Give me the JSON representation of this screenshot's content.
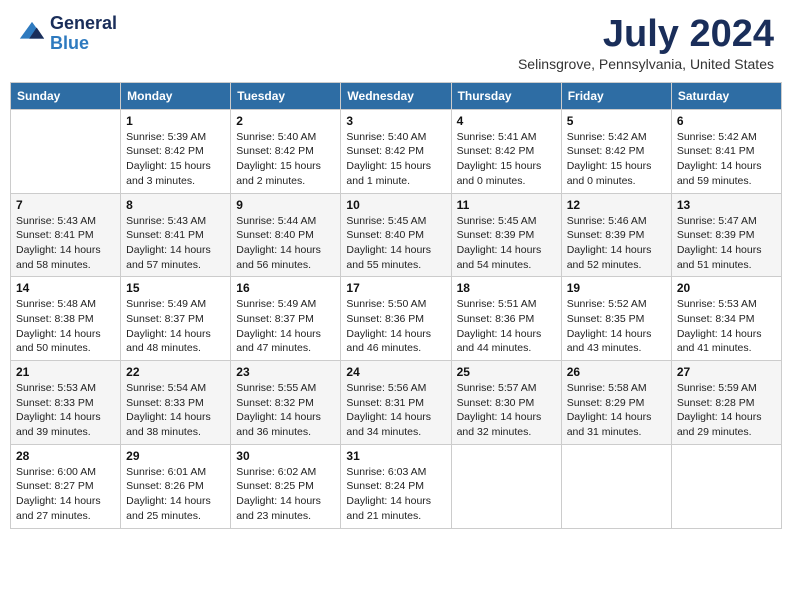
{
  "logo": {
    "general": "General",
    "blue": "Blue"
  },
  "title": "July 2024",
  "location": "Selinsgrove, Pennsylvania, United States",
  "days_of_week": [
    "Sunday",
    "Monday",
    "Tuesday",
    "Wednesday",
    "Thursday",
    "Friday",
    "Saturday"
  ],
  "weeks": [
    [
      {
        "day": "",
        "sunrise": "",
        "sunset": "",
        "daylight": ""
      },
      {
        "day": "1",
        "sunrise": "Sunrise: 5:39 AM",
        "sunset": "Sunset: 8:42 PM",
        "daylight": "Daylight: 15 hours and 3 minutes."
      },
      {
        "day": "2",
        "sunrise": "Sunrise: 5:40 AM",
        "sunset": "Sunset: 8:42 PM",
        "daylight": "Daylight: 15 hours and 2 minutes."
      },
      {
        "day": "3",
        "sunrise": "Sunrise: 5:40 AM",
        "sunset": "Sunset: 8:42 PM",
        "daylight": "Daylight: 15 hours and 1 minute."
      },
      {
        "day": "4",
        "sunrise": "Sunrise: 5:41 AM",
        "sunset": "Sunset: 8:42 PM",
        "daylight": "Daylight: 15 hours and 0 minutes."
      },
      {
        "day": "5",
        "sunrise": "Sunrise: 5:42 AM",
        "sunset": "Sunset: 8:42 PM",
        "daylight": "Daylight: 15 hours and 0 minutes."
      },
      {
        "day": "6",
        "sunrise": "Sunrise: 5:42 AM",
        "sunset": "Sunset: 8:41 PM",
        "daylight": "Daylight: 14 hours and 59 minutes."
      }
    ],
    [
      {
        "day": "7",
        "sunrise": "Sunrise: 5:43 AM",
        "sunset": "Sunset: 8:41 PM",
        "daylight": "Daylight: 14 hours and 58 minutes."
      },
      {
        "day": "8",
        "sunrise": "Sunrise: 5:43 AM",
        "sunset": "Sunset: 8:41 PM",
        "daylight": "Daylight: 14 hours and 57 minutes."
      },
      {
        "day": "9",
        "sunrise": "Sunrise: 5:44 AM",
        "sunset": "Sunset: 8:40 PM",
        "daylight": "Daylight: 14 hours and 56 minutes."
      },
      {
        "day": "10",
        "sunrise": "Sunrise: 5:45 AM",
        "sunset": "Sunset: 8:40 PM",
        "daylight": "Daylight: 14 hours and 55 minutes."
      },
      {
        "day": "11",
        "sunrise": "Sunrise: 5:45 AM",
        "sunset": "Sunset: 8:39 PM",
        "daylight": "Daylight: 14 hours and 54 minutes."
      },
      {
        "day": "12",
        "sunrise": "Sunrise: 5:46 AM",
        "sunset": "Sunset: 8:39 PM",
        "daylight": "Daylight: 14 hours and 52 minutes."
      },
      {
        "day": "13",
        "sunrise": "Sunrise: 5:47 AM",
        "sunset": "Sunset: 8:39 PM",
        "daylight": "Daylight: 14 hours and 51 minutes."
      }
    ],
    [
      {
        "day": "14",
        "sunrise": "Sunrise: 5:48 AM",
        "sunset": "Sunset: 8:38 PM",
        "daylight": "Daylight: 14 hours and 50 minutes."
      },
      {
        "day": "15",
        "sunrise": "Sunrise: 5:49 AM",
        "sunset": "Sunset: 8:37 PM",
        "daylight": "Daylight: 14 hours and 48 minutes."
      },
      {
        "day": "16",
        "sunrise": "Sunrise: 5:49 AM",
        "sunset": "Sunset: 8:37 PM",
        "daylight": "Daylight: 14 hours and 47 minutes."
      },
      {
        "day": "17",
        "sunrise": "Sunrise: 5:50 AM",
        "sunset": "Sunset: 8:36 PM",
        "daylight": "Daylight: 14 hours and 46 minutes."
      },
      {
        "day": "18",
        "sunrise": "Sunrise: 5:51 AM",
        "sunset": "Sunset: 8:36 PM",
        "daylight": "Daylight: 14 hours and 44 minutes."
      },
      {
        "day": "19",
        "sunrise": "Sunrise: 5:52 AM",
        "sunset": "Sunset: 8:35 PM",
        "daylight": "Daylight: 14 hours and 43 minutes."
      },
      {
        "day": "20",
        "sunrise": "Sunrise: 5:53 AM",
        "sunset": "Sunset: 8:34 PM",
        "daylight": "Daylight: 14 hours and 41 minutes."
      }
    ],
    [
      {
        "day": "21",
        "sunrise": "Sunrise: 5:53 AM",
        "sunset": "Sunset: 8:33 PM",
        "daylight": "Daylight: 14 hours and 39 minutes."
      },
      {
        "day": "22",
        "sunrise": "Sunrise: 5:54 AM",
        "sunset": "Sunset: 8:33 PM",
        "daylight": "Daylight: 14 hours and 38 minutes."
      },
      {
        "day": "23",
        "sunrise": "Sunrise: 5:55 AM",
        "sunset": "Sunset: 8:32 PM",
        "daylight": "Daylight: 14 hours and 36 minutes."
      },
      {
        "day": "24",
        "sunrise": "Sunrise: 5:56 AM",
        "sunset": "Sunset: 8:31 PM",
        "daylight": "Daylight: 14 hours and 34 minutes."
      },
      {
        "day": "25",
        "sunrise": "Sunrise: 5:57 AM",
        "sunset": "Sunset: 8:30 PM",
        "daylight": "Daylight: 14 hours and 32 minutes."
      },
      {
        "day": "26",
        "sunrise": "Sunrise: 5:58 AM",
        "sunset": "Sunset: 8:29 PM",
        "daylight": "Daylight: 14 hours and 31 minutes."
      },
      {
        "day": "27",
        "sunrise": "Sunrise: 5:59 AM",
        "sunset": "Sunset: 8:28 PM",
        "daylight": "Daylight: 14 hours and 29 minutes."
      }
    ],
    [
      {
        "day": "28",
        "sunrise": "Sunrise: 6:00 AM",
        "sunset": "Sunset: 8:27 PM",
        "daylight": "Daylight: 14 hours and 27 minutes."
      },
      {
        "day": "29",
        "sunrise": "Sunrise: 6:01 AM",
        "sunset": "Sunset: 8:26 PM",
        "daylight": "Daylight: 14 hours and 25 minutes."
      },
      {
        "day": "30",
        "sunrise": "Sunrise: 6:02 AM",
        "sunset": "Sunset: 8:25 PM",
        "daylight": "Daylight: 14 hours and 23 minutes."
      },
      {
        "day": "31",
        "sunrise": "Sunrise: 6:03 AM",
        "sunset": "Sunset: 8:24 PM",
        "daylight": "Daylight: 14 hours and 21 minutes."
      },
      {
        "day": "",
        "sunrise": "",
        "sunset": "",
        "daylight": ""
      },
      {
        "day": "",
        "sunrise": "",
        "sunset": "",
        "daylight": ""
      },
      {
        "day": "",
        "sunrise": "",
        "sunset": "",
        "daylight": ""
      }
    ]
  ]
}
